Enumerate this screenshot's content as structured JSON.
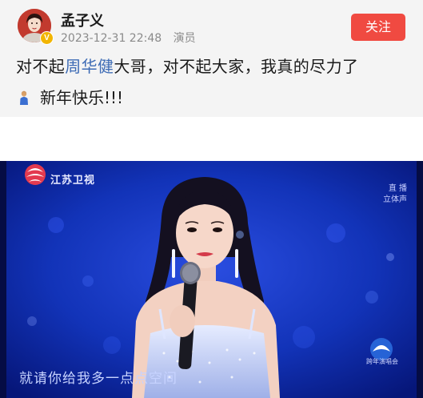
{
  "post": {
    "username": "孟子义",
    "timestamp": "2023-12-31 22:48",
    "profession": "演员",
    "verified_badge": "V",
    "follow_label": "关注",
    "text_before_mention": "对不起",
    "mention": "周华健",
    "text_after_mention": "大哥，对不起大家，我真的尽力了",
    "line2_text": "新年快乐!!!",
    "colors": {
      "follow_button": "#f04a41",
      "mention": "#3d6bb5",
      "background": "#f4f4f4"
    }
  },
  "tv": {
    "channel_name": "江苏卫视",
    "live_tag_line1": "直 播",
    "live_tag_line2": "立体声",
    "subtitle": "就请你给我多一点点空间",
    "corner_logo_text": "跨年演唱会",
    "colors": {
      "stage_background": "#0a1f8e"
    }
  }
}
